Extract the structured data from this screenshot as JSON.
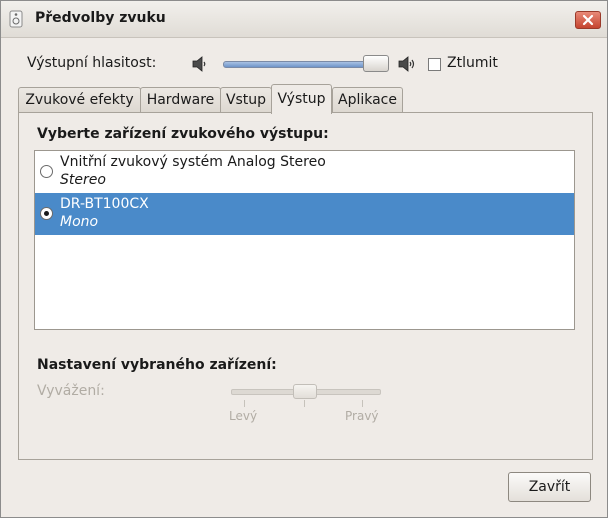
{
  "window": {
    "title": "Předvolby zvuku",
    "close_icon": "close-icon"
  },
  "volume": {
    "label": "Výstupní hlasitost:",
    "level": 0.92,
    "mute_label": "Ztlumit",
    "mute_checked": false
  },
  "tabs": [
    {
      "label": "Zvukové efekty",
      "active": false
    },
    {
      "label": "Hardware",
      "active": false
    },
    {
      "label": "Vstup",
      "active": false
    },
    {
      "label": "Výstup",
      "active": true
    },
    {
      "label": "Aplikace",
      "active": false
    }
  ],
  "output": {
    "heading": "Vyberte zařízení zvukového výstupu:",
    "devices": [
      {
        "name": "Vnitřní zvukový systém Analog Stereo",
        "profile": "Stereo",
        "selected": false
      },
      {
        "name": "DR-BT100CX",
        "profile": "Mono",
        "selected": true
      }
    ]
  },
  "settings": {
    "heading": "Nastavení vybraného zařízení:",
    "balance_label": "Vyvážení:",
    "balance": 0.5,
    "left_label": "Levý",
    "right_label": "Pravý"
  },
  "buttons": {
    "close_label": "Zavřít"
  },
  "colors": {
    "selection": "#4a8ac9",
    "window_bg": "#efebe7",
    "close_button": "#c5442f"
  }
}
